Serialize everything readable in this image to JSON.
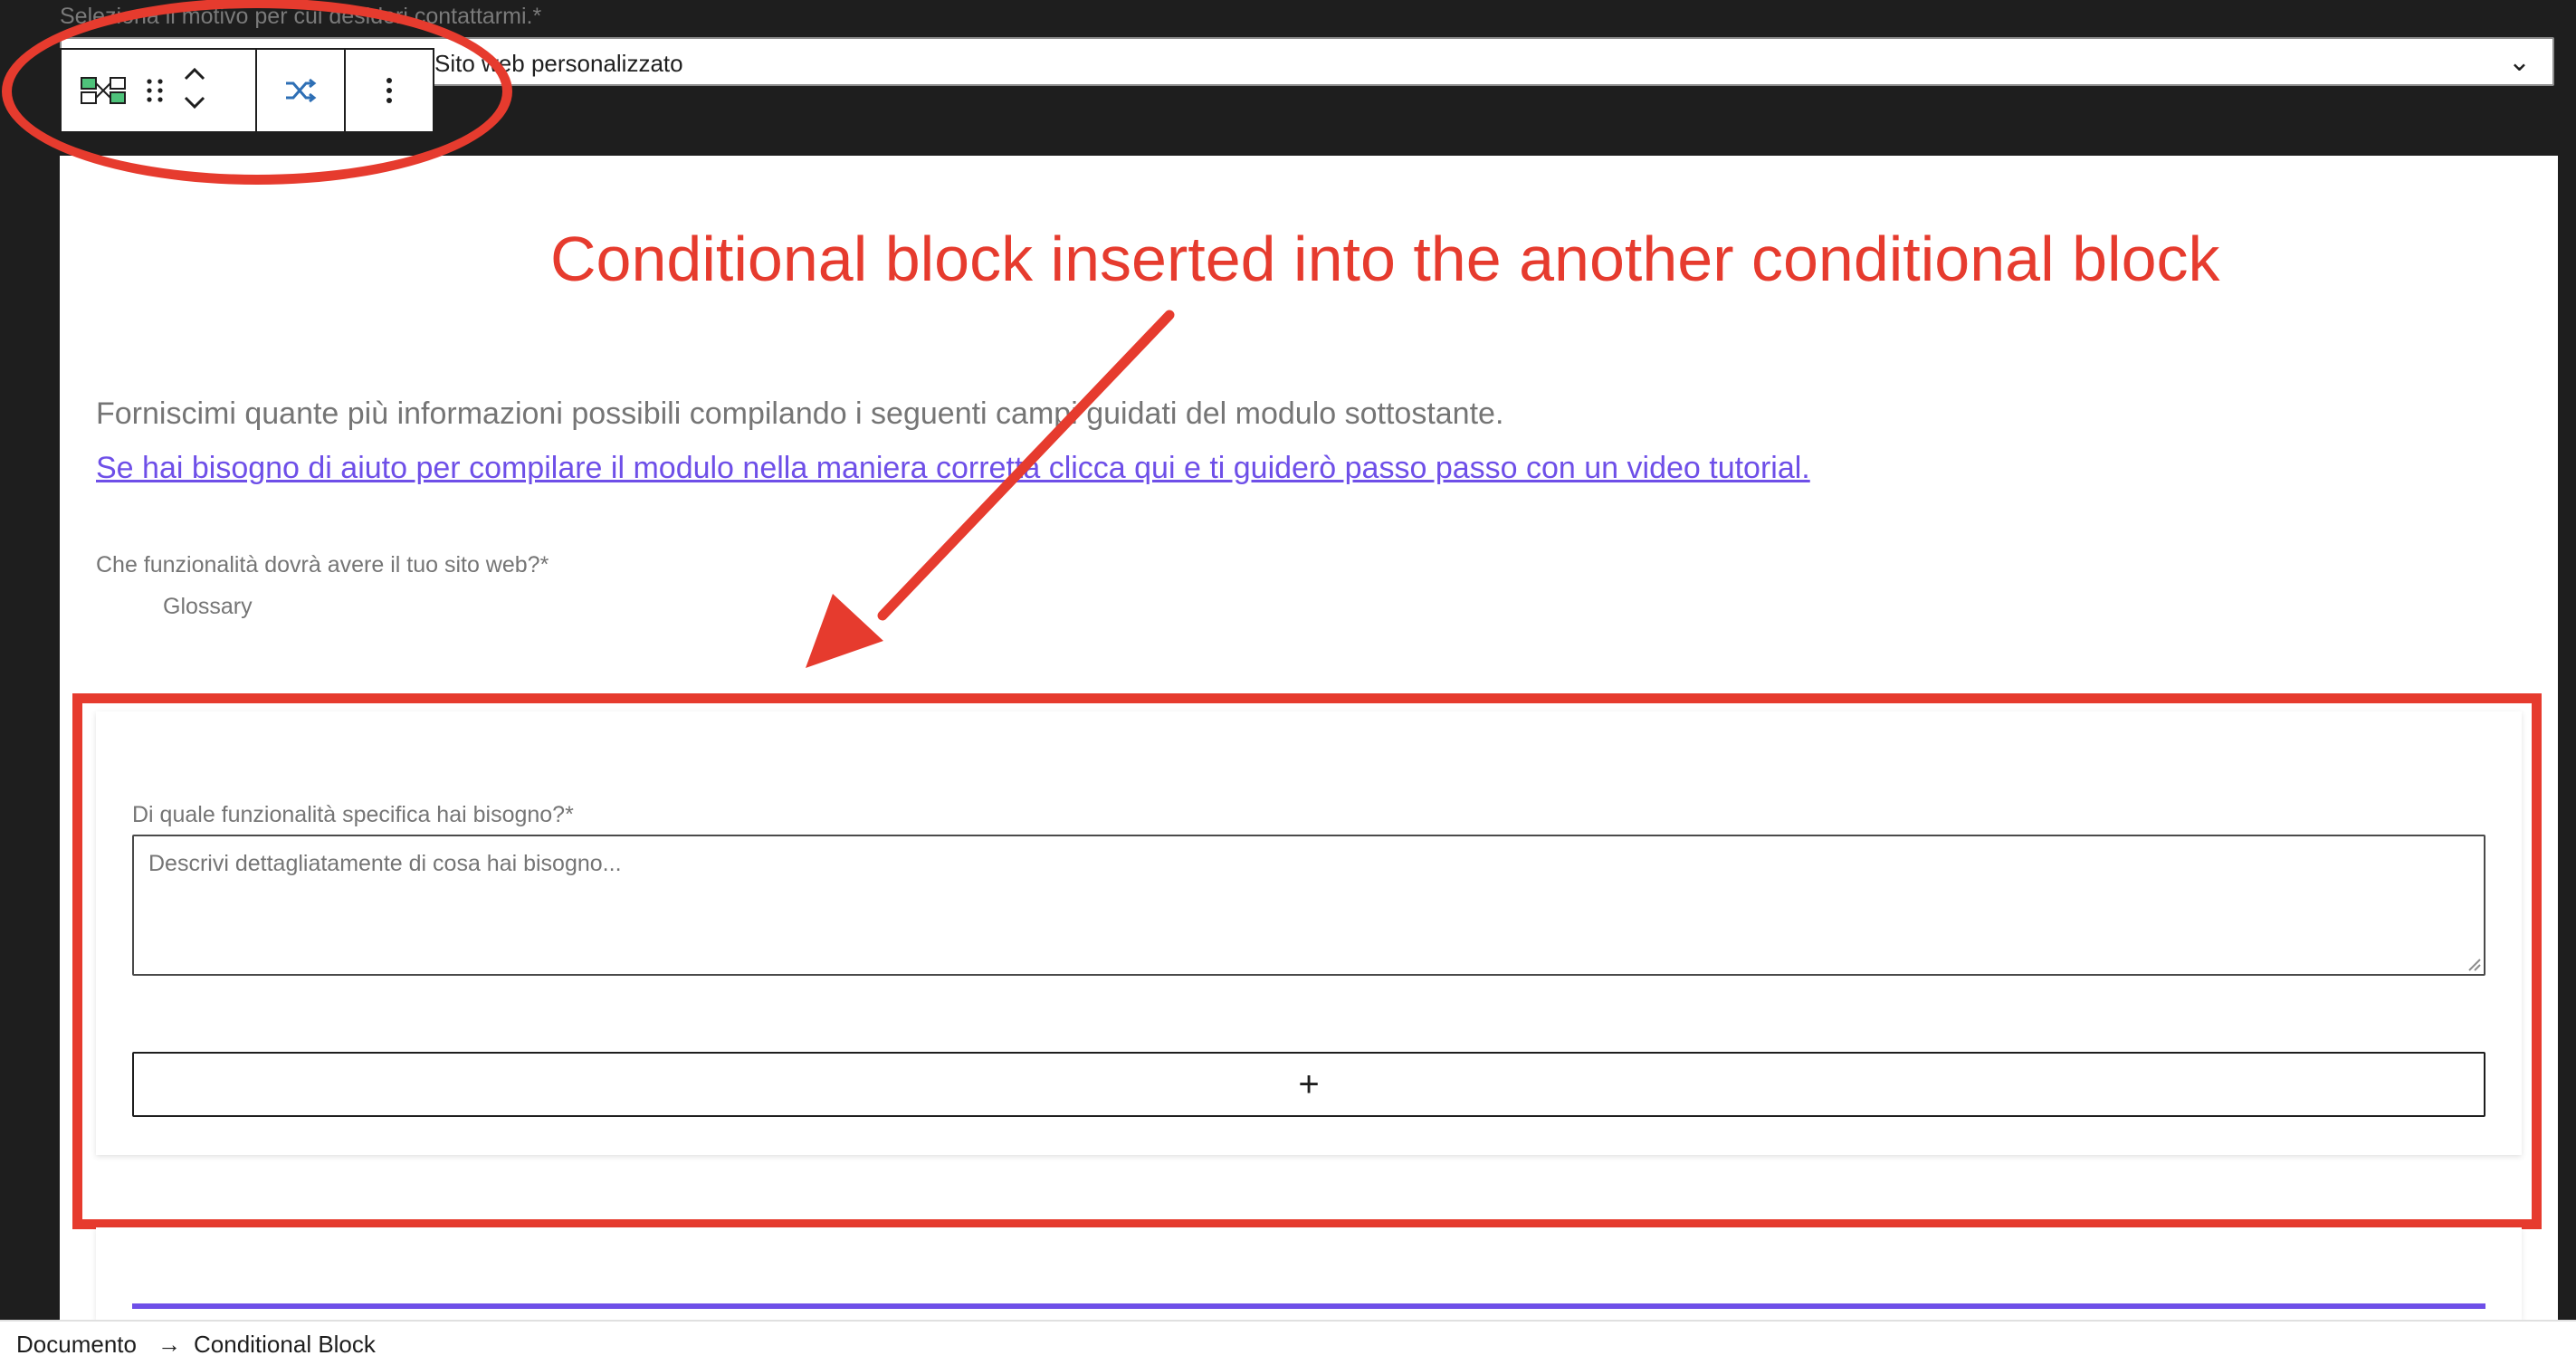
{
  "form": {
    "reason_label": "Seleziona il motivo per cui desideri contattarmi.*",
    "reason_value": "Sito web personalizzato",
    "intro_text": "Forniscimi quante più informazioni possibili compilando i seguenti campi guidati del modulo sottostante.",
    "help_link": "Se hai bisogno di aiuto per compilare il modulo nella maniera corretta clicca qui e ti guiderò passo passo con un video tutorial.",
    "features_label": "Che funzionalità dovrà avere il tuo sito web?*",
    "features_value": "Glossary",
    "specific_label": "Di quale funzionalità specifica hai bisogno?*",
    "specific_placeholder": "Descrivi dettagliatamente di cosa hai bisogno...",
    "add_block_label": "+"
  },
  "annotation": {
    "text": "Conditional block inserted into the another conditional block",
    "color": "#e63b2e"
  },
  "breadcrumb": {
    "items": [
      "Documento",
      "Conditional Block"
    ],
    "separator": "→"
  },
  "colors": {
    "accent": "#6e4fe8",
    "dark_chrome": "#1e1e1e",
    "muted_text": "#757575",
    "transform_icon": "#2e6fb5"
  },
  "toolbar": {
    "icons": [
      "block-type-icon",
      "drag-handle-icon",
      "move-up-icon",
      "move-down-icon",
      "transform-icon",
      "more-options-icon"
    ]
  }
}
